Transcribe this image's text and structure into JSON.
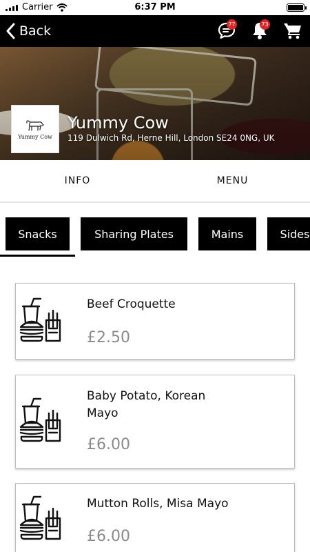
{
  "status_bar": {
    "carrier": "Carrier",
    "time": "6:37 PM"
  },
  "nav": {
    "back_label": "Back",
    "chat_badge": "77",
    "notification_badge": "73",
    "icons": [
      "chevron-left-icon",
      "chat-icon",
      "bell-icon",
      "cart-icon"
    ]
  },
  "restaurant": {
    "name": "Yummy Cow",
    "address": "119 Dulwich Rd, Herne Hill, London SE24 0NG, UK",
    "logo_text": "Yummy Cow"
  },
  "main_tabs": [
    {
      "label": "INFO"
    },
    {
      "label": "MENU"
    }
  ],
  "categories": [
    {
      "label": "Snacks",
      "selected": true
    },
    {
      "label": "Sharing Plates",
      "selected": false
    },
    {
      "label": "Mains",
      "selected": false
    },
    {
      "label": "Sides",
      "selected": false
    }
  ],
  "menu_items": [
    {
      "name": "Beef Croquette",
      "price": "£2.50"
    },
    {
      "name": "Baby Potato, Korean Mayo",
      "price": "£6.00"
    },
    {
      "name": "Mutton Rolls, Misa Mayo",
      "price": "£6.00"
    }
  ],
  "colors": {
    "nav_background": "#000000",
    "badge": "#e02424",
    "pill_background": "#000000",
    "price_text": "#8a8a8a"
  }
}
